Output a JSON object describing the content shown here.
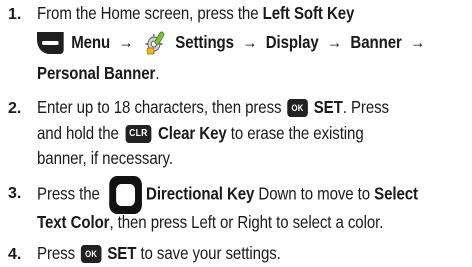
{
  "steps": [
    {
      "number": "1.",
      "lines": [
        {
          "a": "From the Home screen, press the ",
          "b": "Left Soft Key"
        },
        {
          "menu": "Menu",
          "arrow1": "→",
          "settings": "Settings",
          "arrow2": "→",
          "display": "Display",
          "arrow3": "→",
          "banner": "Banner",
          "arrow4": "→"
        },
        {
          "b": "Personal Banner",
          "a": "."
        }
      ]
    },
    {
      "number": "2.",
      "lines": [
        {
          "a": "Enter up to 18 characters, then press ",
          "key": "OK",
          "b": "SET",
          "c": ". Press"
        },
        {
          "a": "and hold the ",
          "key": "CLR",
          "b": "Clear Key",
          "c": " to erase the existing"
        },
        {
          "a": "banner, if necessary."
        }
      ]
    },
    {
      "number": "3.",
      "lines": [
        {
          "a": "Press the ",
          "b": "Directional Key",
          "c": " Down to move to ",
          "d": "Select"
        },
        {
          "b": "Text Color",
          "a": ", then press Left or Right to select a color."
        }
      ]
    },
    {
      "number": "4.",
      "lines": [
        {
          "a": "Press ",
          "key": "OK",
          "b": "SET",
          "c": " to save your settings."
        }
      ]
    }
  ],
  "icons": {
    "left_soft_key": "left-soft-key-icon",
    "settings": "settings-icon",
    "ok_key": "ok-key-icon",
    "clr_key": "clr-key-icon",
    "directional_key": "directional-key-icon"
  }
}
